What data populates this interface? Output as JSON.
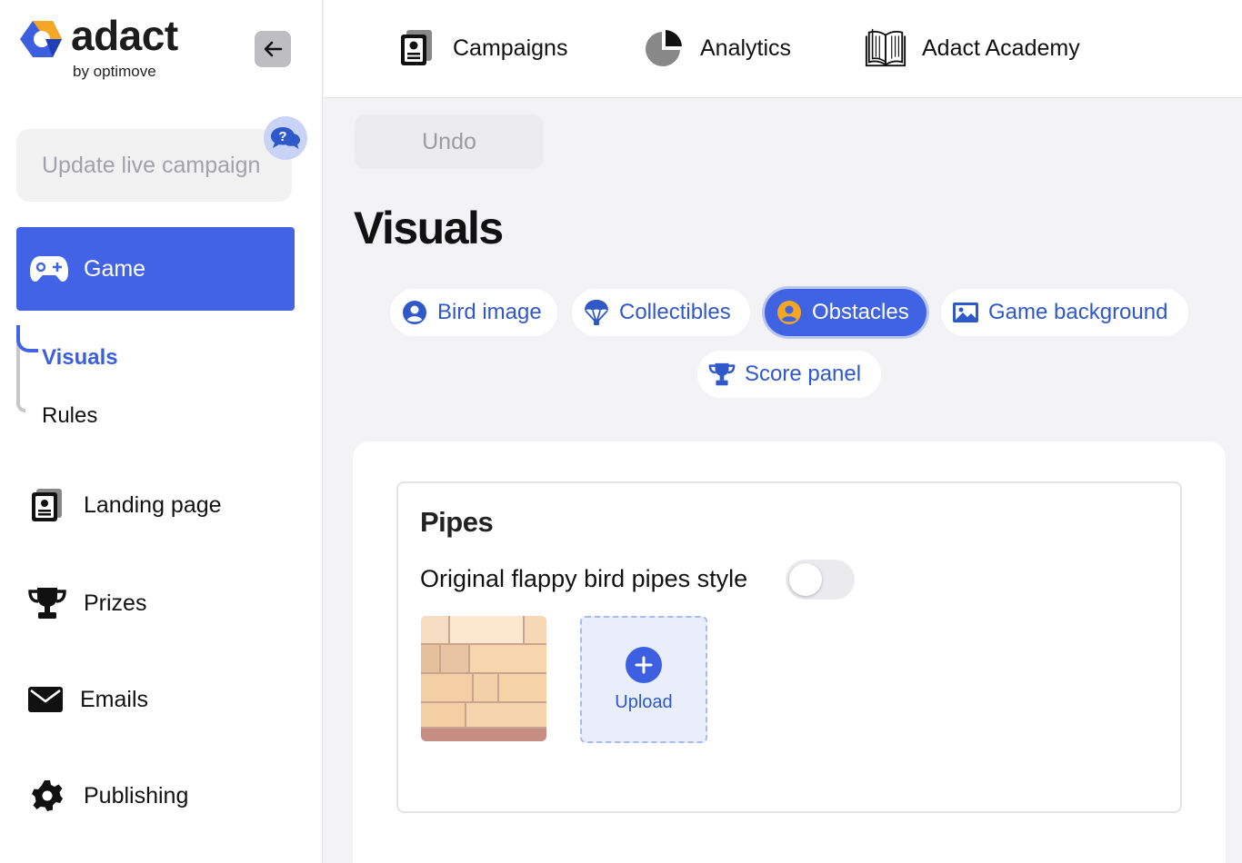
{
  "brand": {
    "name": "adact",
    "sub": "by optimove"
  },
  "sidebar": {
    "update_button": "Update live campaign",
    "game_label": "Game",
    "sub_items": [
      {
        "label": "Visuals",
        "active": true
      },
      {
        "label": "Rules",
        "active": false
      }
    ],
    "items": [
      {
        "label": "Landing page",
        "icon": "landing-page-icon"
      },
      {
        "label": "Prizes",
        "icon": "trophy-icon"
      },
      {
        "label": "Emails",
        "icon": "envelope-icon"
      },
      {
        "label": "Publishing",
        "icon": "gear-icon"
      }
    ]
  },
  "topnav": {
    "items": [
      {
        "label": "Campaigns",
        "icon": "campaigns-icon"
      },
      {
        "label": "Analytics",
        "icon": "pie-chart-icon"
      },
      {
        "label": "Adact Academy",
        "icon": "book-icon"
      }
    ]
  },
  "main": {
    "undo_label": "Undo",
    "page_title": "Visuals",
    "tabs": [
      {
        "label": "Bird image",
        "icon": "user-circle-icon",
        "active": false
      },
      {
        "label": "Collectibles",
        "icon": "parachute-icon",
        "active": false
      },
      {
        "label": "Obstacles",
        "icon": "user-circle-icon",
        "active": true
      },
      {
        "label": "Game background",
        "icon": "image-icon",
        "active": false
      },
      {
        "label": "Score panel",
        "icon": "trophy-icon",
        "active": false
      }
    ],
    "section": {
      "title": "Pipes",
      "toggle_label": "Original flappy bird pipes style",
      "toggle_on": false,
      "upload_label": "Upload"
    }
  },
  "colors": {
    "accent": "#4263e6",
    "link": "#2f58c9",
    "orange": "#f5a623"
  }
}
